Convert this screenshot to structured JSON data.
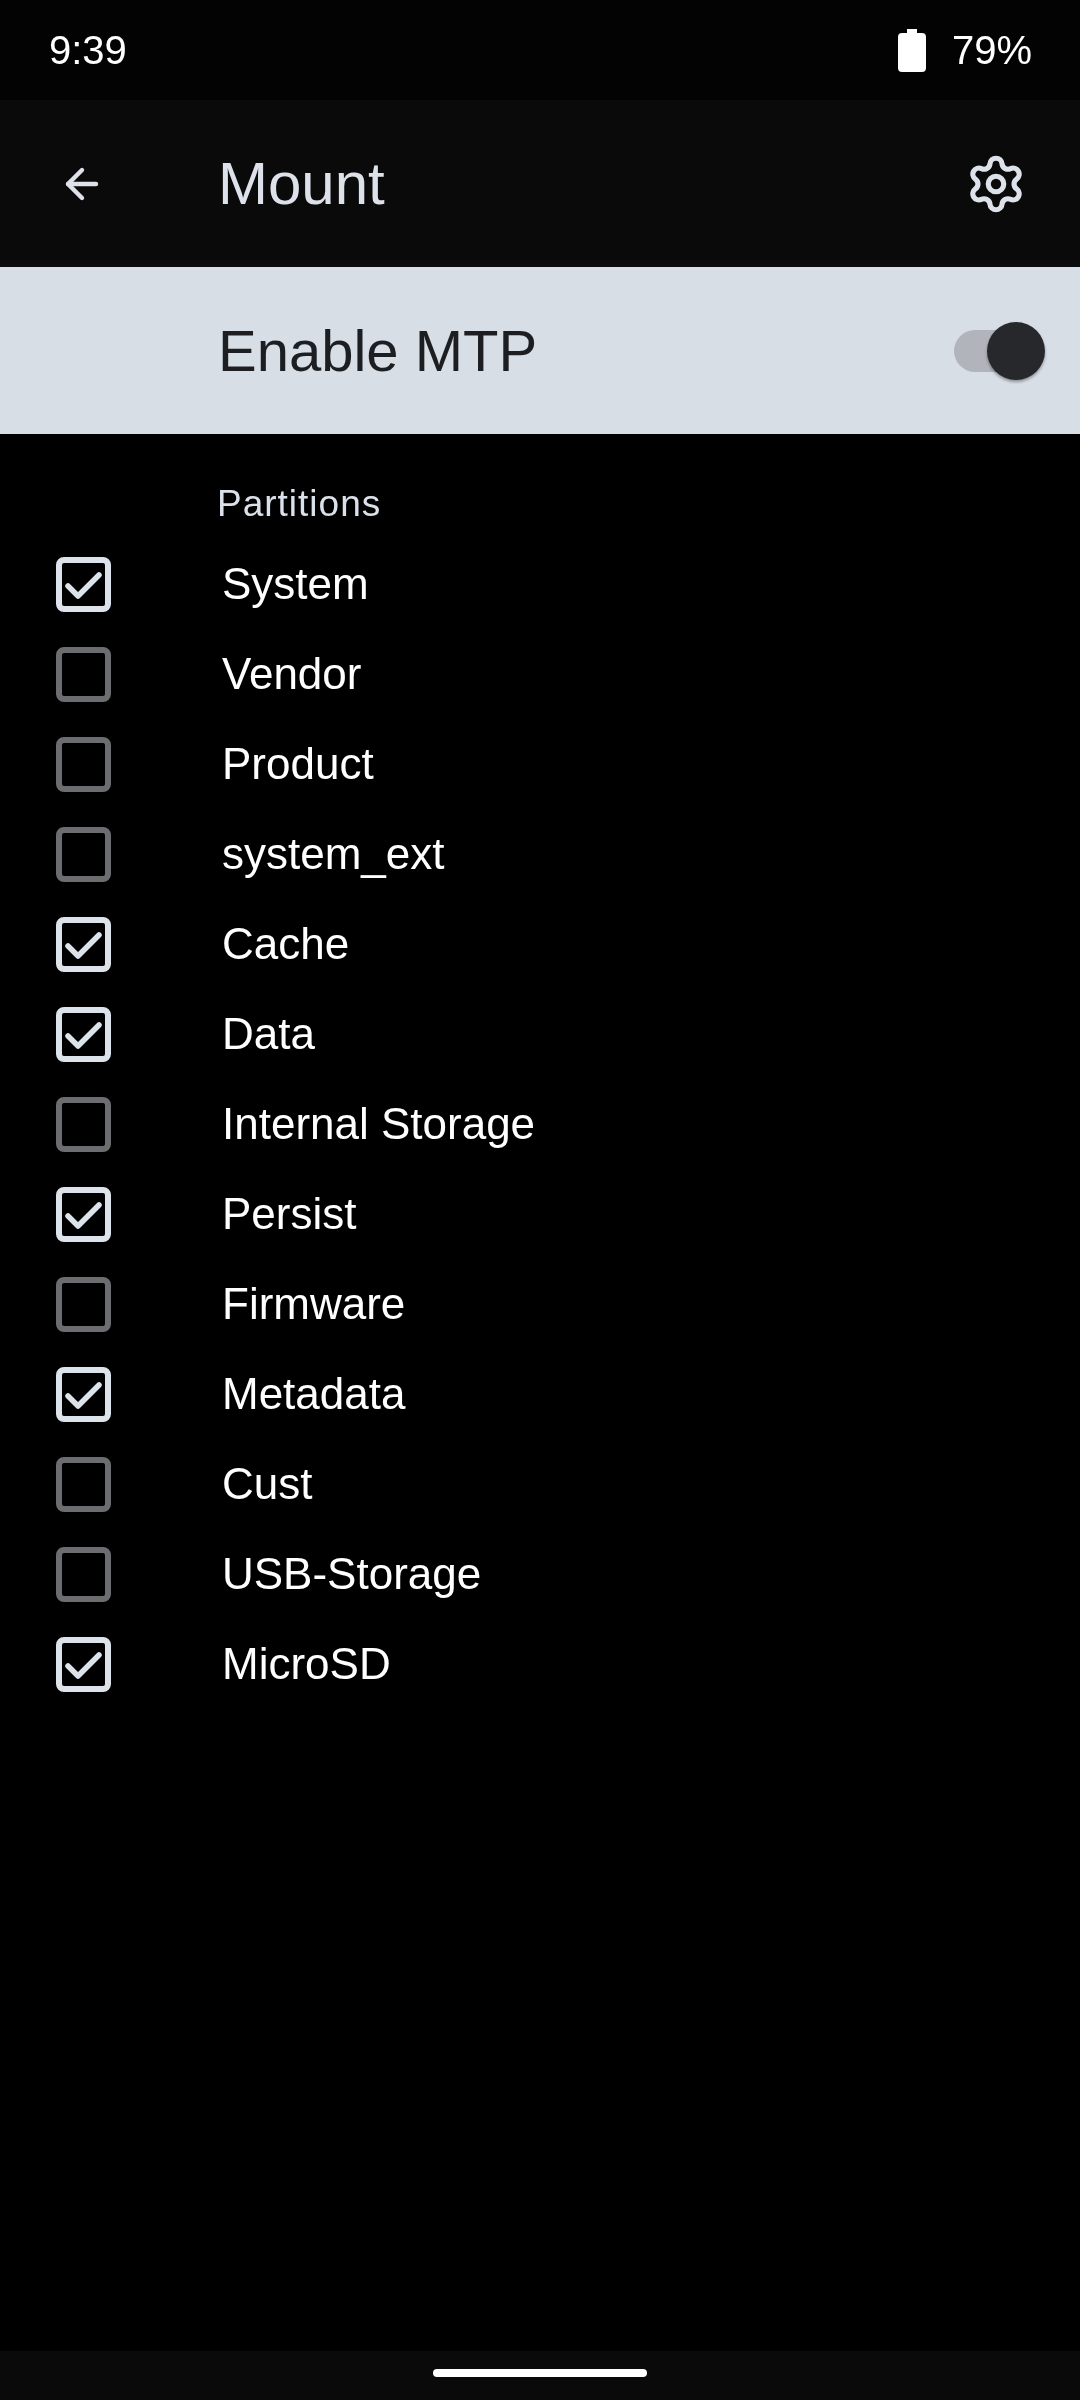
{
  "status_bar": {
    "time": "9:39",
    "battery": "79%"
  },
  "app_bar": {
    "title": "Mount"
  },
  "mtp": {
    "label": "Enable MTP",
    "on": true
  },
  "partitions": {
    "heading": "Partitions",
    "items": [
      {
        "label": "System",
        "checked": true
      },
      {
        "label": "Vendor",
        "checked": false
      },
      {
        "label": "Product",
        "checked": false
      },
      {
        "label": "system_ext",
        "checked": false
      },
      {
        "label": "Cache",
        "checked": true
      },
      {
        "label": "Data",
        "checked": true
      },
      {
        "label": "Internal Storage",
        "checked": false
      },
      {
        "label": "Persist",
        "checked": true
      },
      {
        "label": "Firmware",
        "checked": false
      },
      {
        "label": "Metadata",
        "checked": true
      },
      {
        "label": "Cust",
        "checked": false
      },
      {
        "label": "USB-Storage",
        "checked": false
      },
      {
        "label": "MicroSD",
        "checked": true
      }
    ]
  }
}
